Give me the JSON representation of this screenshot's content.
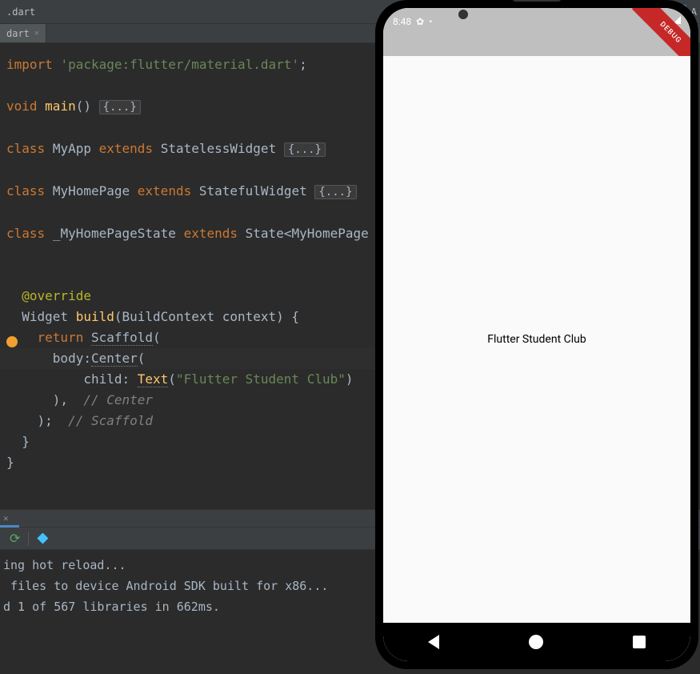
{
  "top": {
    "tab_truncated": ".dart",
    "device_truncated": "A"
  },
  "file_tab": {
    "name": "dart"
  },
  "code": {
    "l1_kw": "import",
    "l1_str": "'package:flutter/material.dart'",
    "l1_semi": ";",
    "l3_kw": "void",
    "l3_fn": "main",
    "l3_paren": "()",
    "l3_fold": "{...}",
    "l5_kw": "class",
    "l5_name": "MyApp",
    "l5_ext": "extends",
    "l5_type": "StatelessWidget",
    "l5_fold": "{...}",
    "l7_kw": "class",
    "l7_name": "MyHomePage",
    "l7_ext": "extends",
    "l7_type": "StatefulWidget",
    "l7_fold": "{...}",
    "l9_kw": "class",
    "l9_name": "_MyHomePageState",
    "l9_ext": "extends",
    "l9_type": "State<MyHomePage",
    "l12_anno": "@override",
    "l13_type": "Widget",
    "l13_fn": "build",
    "l13_args": "(BuildContext context) {",
    "l14_kw": "return",
    "l14_type": "Scaffold",
    "l14_paren": "(",
    "l15_param": "body:",
    "l15_type": "Center",
    "l15_paren": "(",
    "l16_param": "child:",
    "l16_type": "Text",
    "l16_open": "(",
    "l16_str": "\"Flutter Student Club\"",
    "l16_close": ")",
    "l17_close": "),",
    "l17_comment": "// Center",
    "l18_close": ");",
    "l18_comment": "// Scaffold",
    "l19_close": "}",
    "l20_close": "}"
  },
  "console": {
    "line1": "ing hot reload...",
    "line2": " files to device Android SDK built for x86...",
    "line3": "d 1 of 567 libraries in 662ms."
  },
  "emulator": {
    "time": "8:48",
    "debug_label": "DEBUG",
    "app_text": "Flutter Student Club"
  }
}
